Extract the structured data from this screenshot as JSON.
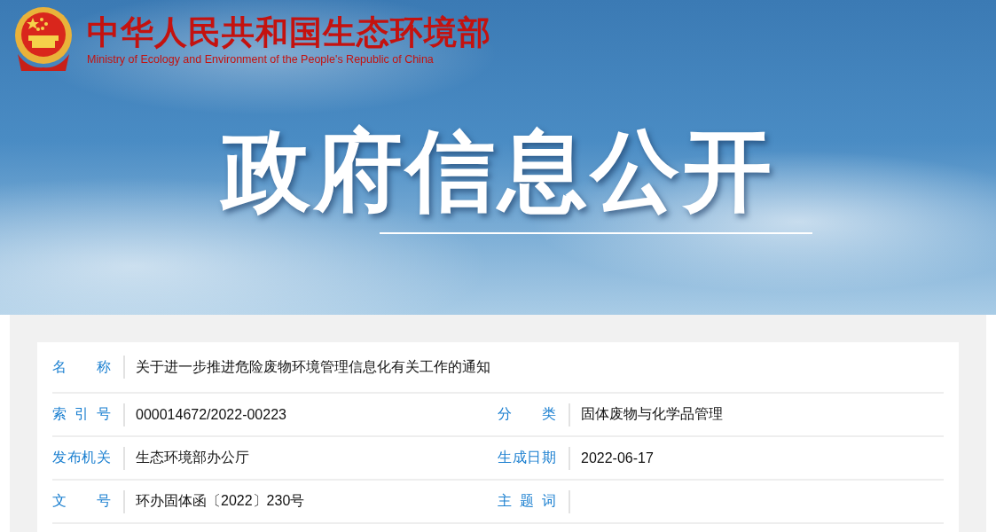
{
  "header": {
    "title": "中华人民共和国生态环境部",
    "subtitle": "Ministry of Ecology and Environment of the People's Republic of China"
  },
  "banner": {
    "title": "政府信息公开"
  },
  "info": {
    "title_row": {
      "label": "名 称",
      "value": "关于进一步推进危险废物环境管理信息化有关工作的通知"
    },
    "rows": [
      {
        "left": {
          "label": "索 引 号",
          "value": "000014672/2022-00223"
        },
        "right": {
          "label": "分 类",
          "value": "固体废物与化学品管理"
        }
      },
      {
        "left": {
          "label": "发布机关",
          "value": "生态环境部办公厅"
        },
        "right": {
          "label": "生成日期",
          "value": "2022-06-17"
        }
      },
      {
        "left": {
          "label": "文 号",
          "value": "环办固体函〔2022〕230号"
        },
        "right": {
          "label": "主 题 词"
        }
      }
    ]
  }
}
